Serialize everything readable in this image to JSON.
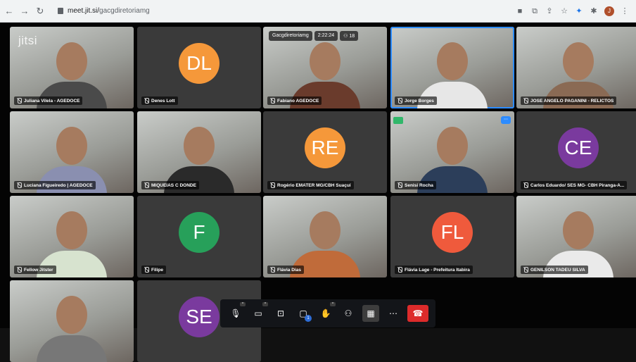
{
  "browser": {
    "url_host": "meet.jit.si/",
    "url_path": "gacgdiretoriamg",
    "back_icon": "back-arrow-icon",
    "forward_icon": "forward-arrow-icon",
    "reload_icon": "reload-icon",
    "profile_initial": "J"
  },
  "meeting": {
    "logo_text": "jitsi",
    "room_name": "Gacgdiretoriamg",
    "timer": "2:22:24",
    "participant_count": "18"
  },
  "participants": [
    {
      "name": "Juliana Vilela - AGEDOCE",
      "type": "video"
    },
    {
      "name": "Denes Lott",
      "type": "avatar",
      "initials": "DL",
      "color": "#f5983a"
    },
    {
      "name": "Fabiano AGEDOCE",
      "type": "video"
    },
    {
      "name": "Jorge Borges",
      "type": "video",
      "active": true
    },
    {
      "name": "JOSE ANGELO PAGANINI - RELICTOS",
      "type": "video"
    },
    {
      "name": "Luciana Figueiredo | AGEDOCE",
      "type": "video"
    },
    {
      "name": "MIQUEIAS C DONDE",
      "type": "video"
    },
    {
      "name": "Rogério EMATER MG/CBH Suaçuí",
      "type": "avatar",
      "initials": "RE",
      "color": "#f5983a"
    },
    {
      "name": "Senisi Rocha",
      "type": "video"
    },
    {
      "name": "Carlos Eduardo/ SES MG- CBH Piranga-A...",
      "type": "avatar",
      "initials": "CE",
      "color": "#7a3a9e"
    },
    {
      "name": "Fellow Jitster",
      "type": "video"
    },
    {
      "name": "Filipe",
      "type": "avatar",
      "initials": "F",
      "color": "#27a05a"
    },
    {
      "name": "Flávia Dias",
      "type": "video"
    },
    {
      "name": "Flávia Lage - Prefeitura Itabira",
      "type": "avatar",
      "initials": "FL",
      "color": "#ef5a3c"
    },
    {
      "name": "GENILSON TADEU SILVA",
      "type": "video"
    },
    {
      "name": "",
      "type": "video"
    },
    {
      "name": "",
      "type": "avatar",
      "initials": "SE",
      "color": "#7a3a9e"
    }
  ],
  "toolbar": {
    "raise_hand_count": "1",
    "buttons": [
      "microphone-icon",
      "camera-icon",
      "screenshare-icon",
      "chat-icon",
      "raise-hand-icon",
      "participants-icon",
      "tile-view-icon",
      "more-icon",
      "hangup-icon"
    ]
  },
  "colors": {
    "tile_background": "#3a3a3a",
    "active_speaker": "#2d8cff",
    "hangup": "#dd2b2b"
  }
}
